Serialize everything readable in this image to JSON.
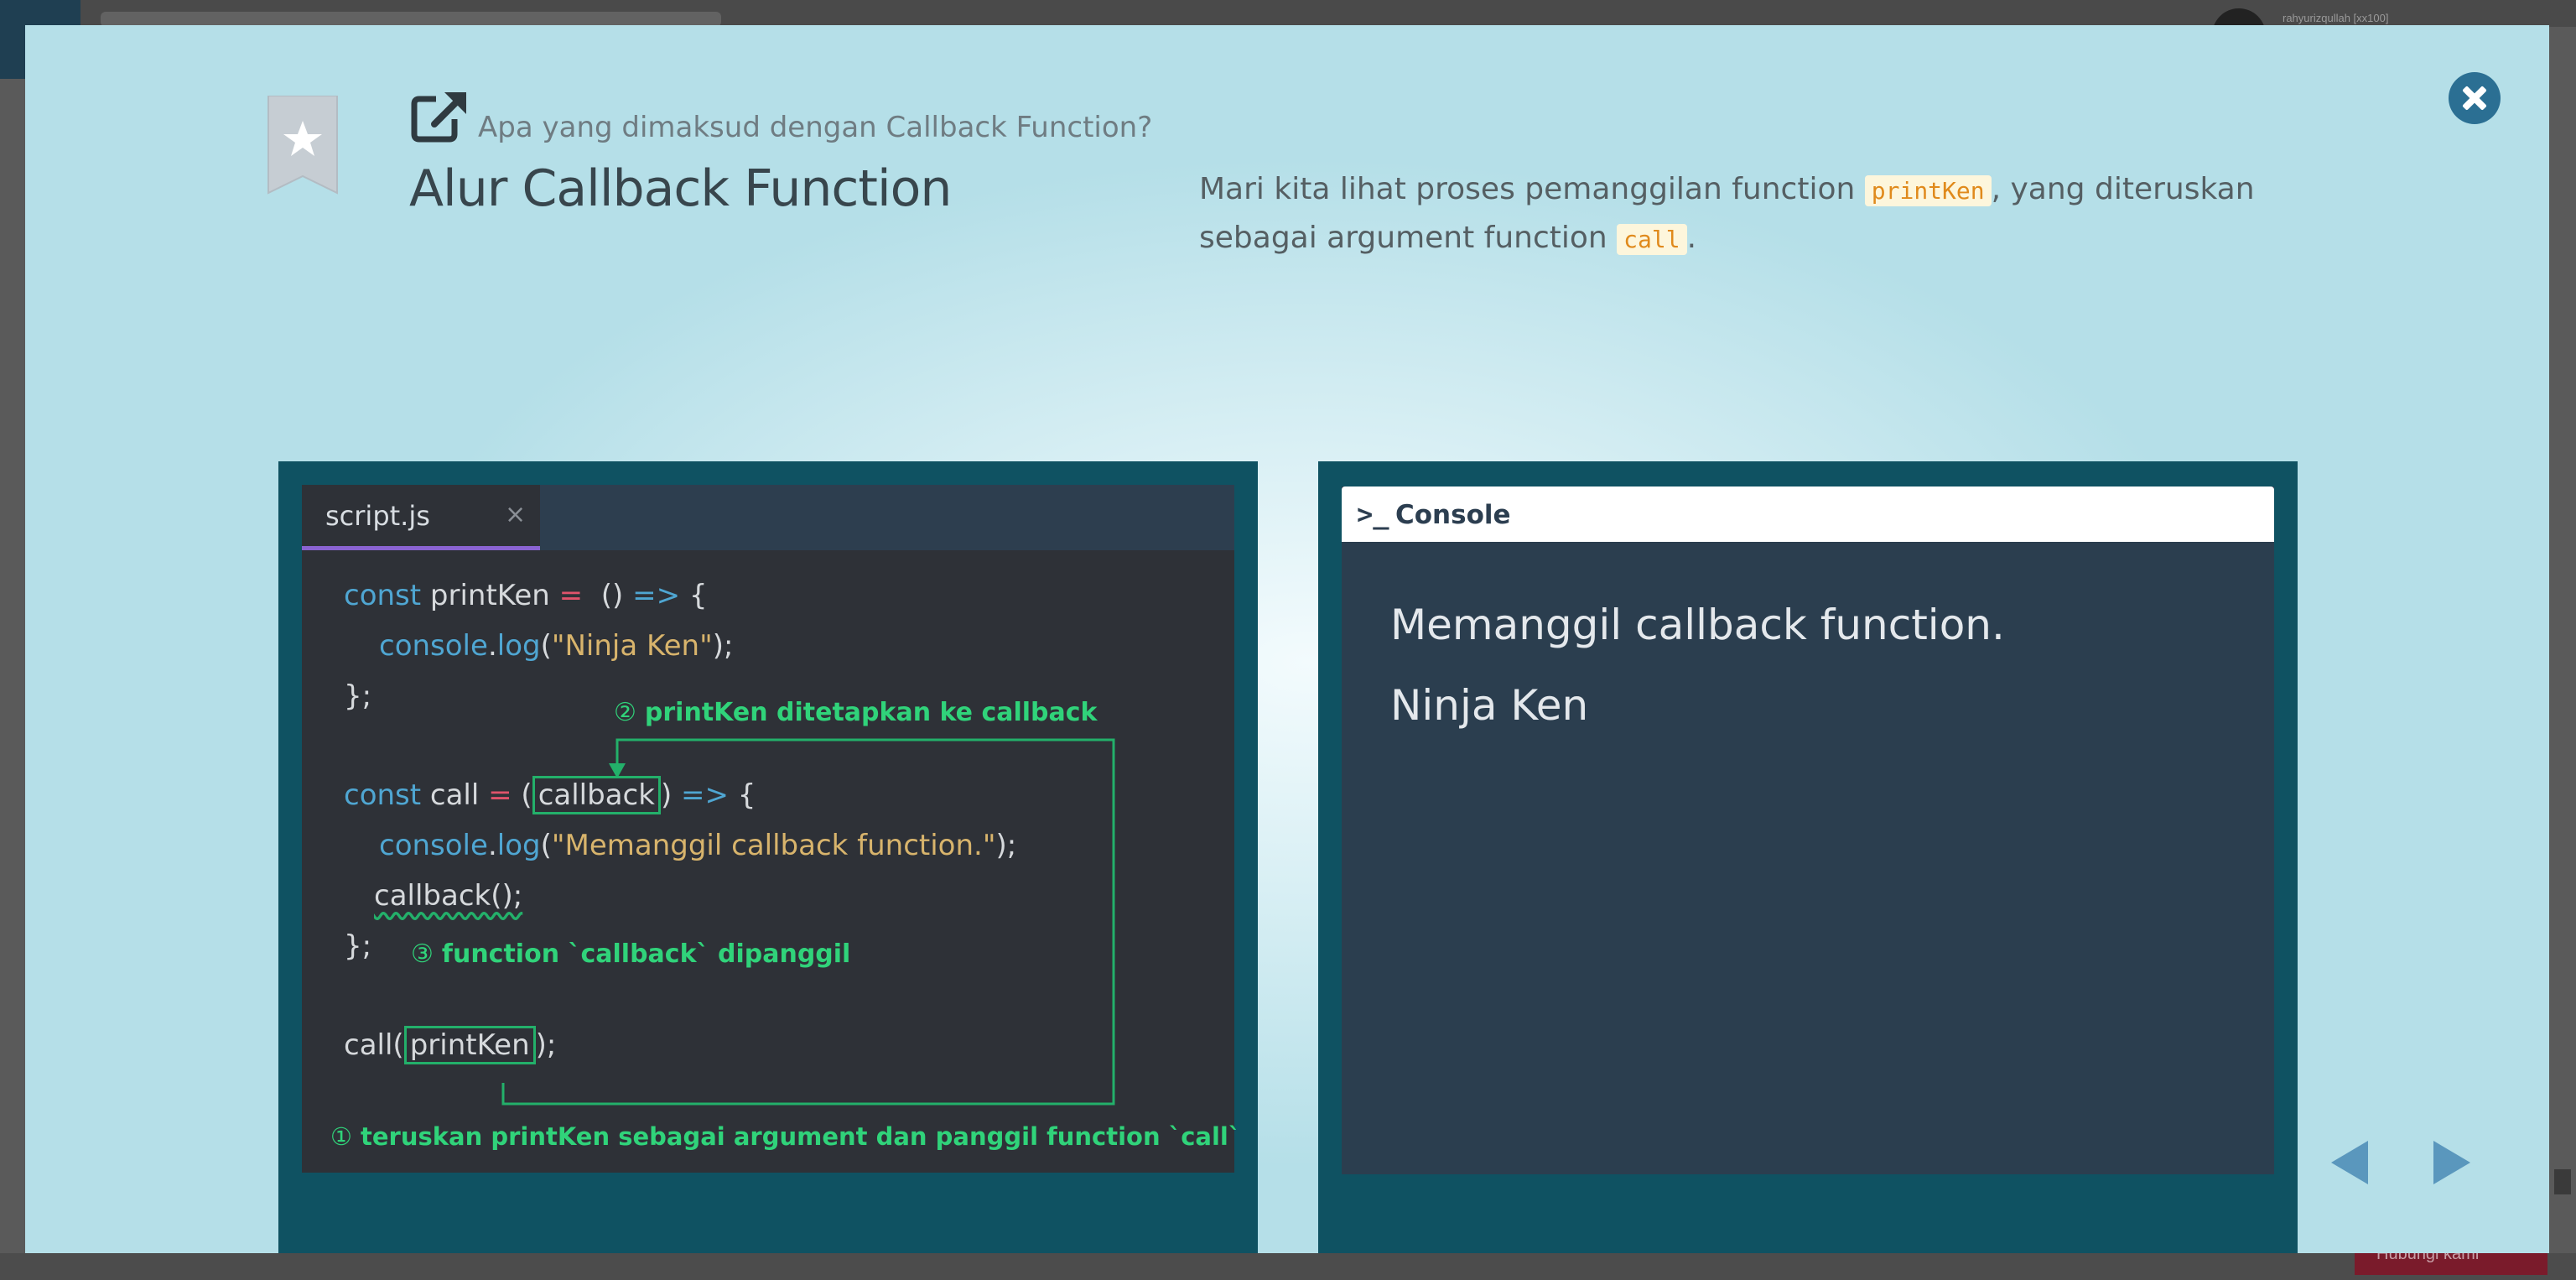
{
  "background": {
    "user_label": "rahyurizqullah [xx100]",
    "bottom_button_label": "Hubungi kami"
  },
  "modal": {
    "subtitle": "Apa yang dimaksud dengan Callback Function?",
    "title": "Alur Callback Function",
    "description": {
      "part1": "Mari kita lihat proses pemanggilan function ",
      "code1": "printKen",
      "part2": ", yang diteruskan sebagai argument function ",
      "code2": "call",
      "part3": "."
    },
    "icons": {
      "bookmark": "bookmark-star-icon",
      "external": "external-link-icon",
      "close": "close-icon",
      "prev": "triangle-left-icon",
      "next": "triangle-right-icon"
    },
    "colors": {
      "panel_border": "#0f5262",
      "editor_bg": "#2e3137",
      "console_bg": "#2b3e4f",
      "annotation_green": "#30d37a",
      "close_button": "#2b6f93"
    }
  },
  "editor": {
    "tab_name": "script.js",
    "tab_close": "×",
    "code": {
      "l1_kw": "const",
      "l1_name": " printKen",
      "l1_eq": " =",
      "l1_paren": "  ()",
      "l1_arrow": " =>",
      "l1_brace": " {",
      "l2_obj": "console",
      "l2_dot": ".",
      "l2_fn": "log",
      "l2_open": "(",
      "l2_str": "\"Ninja Ken\"",
      "l2_close": ");",
      "l3": "};",
      "l5_kw": "const",
      "l5_name": " call",
      "l5_eq": " =",
      "l5_open": " (",
      "l5_param": "callback",
      "l5_close": ")",
      "l5_arrow": " =>",
      "l5_brace": " {",
      "l6_obj": "console",
      "l6_dot": ".",
      "l6_fn": "log",
      "l6_open": "(",
      "l6_str": "\"Memanggil callback function.\"",
      "l6_close": ");",
      "l7": "callback();",
      "l8": "};",
      "l10_call": "call(",
      "l10_arg": "printKen",
      "l10_end": ");"
    },
    "annotations": {
      "n2_num": "②",
      "n2_text": "printKen ditetapkan ke callback",
      "n3_num": "③",
      "n3_text": "function `callback` dipanggil",
      "n1_num": "①",
      "n1_text": "teruskan printKen sebagai argument dan panggil function `call`"
    }
  },
  "console": {
    "icon": "terminal-prompt-icon",
    "prompt_glyph": ">_",
    "title": "Console",
    "output": [
      "Memanggil callback function.",
      "Ninja Ken"
    ]
  }
}
